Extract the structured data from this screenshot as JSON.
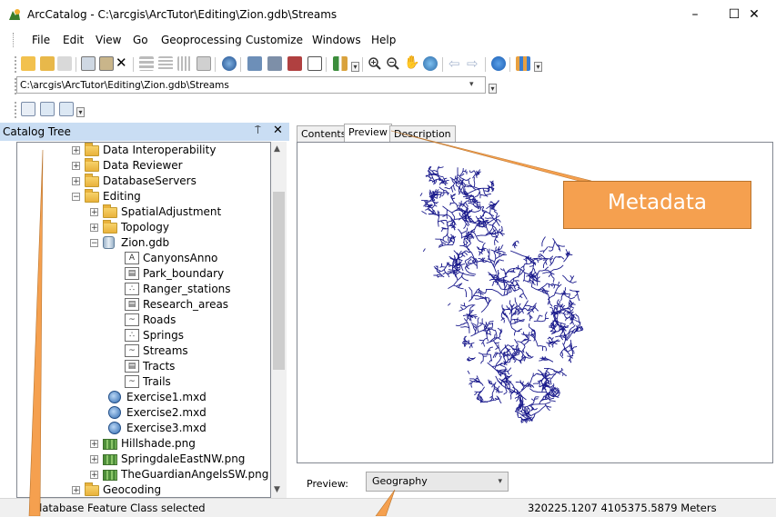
{
  "window": {
    "title": "ArcCatalog - C:\\arcgis\\ArcTutor\\Editing\\Zion.gdb\\Streams",
    "minimize": "–",
    "maximize": "☐",
    "close": "✕"
  },
  "menu": [
    "File",
    "Edit",
    "View",
    "Go",
    "Geoprocessing",
    "Customize",
    "Windows",
    "Help"
  ],
  "toolbar_icons": [
    "up-one-level-icon",
    "connect-folder-icon",
    "disconnect-folder-icon",
    "copy-icon",
    "paste-icon",
    "delete-icon",
    "large-icons-icon",
    "list-icon",
    "details-icon",
    "thumbnails-icon",
    "launch-arcmap-icon",
    "catalog-tree-icon",
    "search-window-icon",
    "arctoolbox-icon",
    "python-icon",
    "modelbuilder-icon",
    "zoom-in-icon",
    "zoom-out-icon",
    "pan-icon",
    "full-extent-icon",
    "back-icon",
    "forward-icon",
    "identify-icon",
    "generate-preview-icon"
  ],
  "location": {
    "path": "C:\\arcgis\\ArcTutor\\Editing\\Zion.gdb\\Streams"
  },
  "catalog_tree": {
    "title": "Catalog Tree",
    "pin": "⍑",
    "close": "✕",
    "items": [
      {
        "label": "Data Interoperability",
        "icon": "folder",
        "expander": "+",
        "level": 0
      },
      {
        "label": "Data Reviewer",
        "icon": "folder",
        "expander": "+",
        "level": 0
      },
      {
        "label": "DatabaseServers",
        "icon": "folder",
        "expander": "+",
        "level": 0
      },
      {
        "label": "Editing",
        "icon": "folder",
        "expander": "−",
        "level": 0
      },
      {
        "label": "SpatialAdjustment",
        "icon": "folder",
        "expander": "+",
        "level": 1
      },
      {
        "label": "Topology",
        "icon": "folder",
        "expander": "+",
        "level": 1
      },
      {
        "label": "Zion.gdb",
        "icon": "geodatabase",
        "expander": "−",
        "level": 1
      },
      {
        "label": "CanyonsAnno",
        "icon": "annotation",
        "expander": "",
        "level": 2
      },
      {
        "label": "Park_boundary",
        "icon": "polygon",
        "expander": "",
        "level": 2
      },
      {
        "label": "Ranger_stations",
        "icon": "point",
        "expander": "",
        "level": 2
      },
      {
        "label": "Research_areas",
        "icon": "polygon",
        "expander": "",
        "level": 2
      },
      {
        "label": "Roads",
        "icon": "line",
        "expander": "",
        "level": 2
      },
      {
        "label": "Springs",
        "icon": "point",
        "expander": "",
        "level": 2
      },
      {
        "label": "Streams",
        "icon": "line",
        "expander": "",
        "level": 2
      },
      {
        "label": "Tracts",
        "icon": "polygon",
        "expander": "",
        "level": 2
      },
      {
        "label": "Trails",
        "icon": "line",
        "expander": "",
        "level": 2
      },
      {
        "label": "Exercise1.mxd",
        "icon": "mxd",
        "expander": "",
        "level": 1
      },
      {
        "label": "Exercise2.mxd",
        "icon": "mxd",
        "expander": "",
        "level": 1
      },
      {
        "label": "Exercise3.mxd",
        "icon": "mxd",
        "expander": "",
        "level": 1
      },
      {
        "label": "Hillshade.png",
        "icon": "raster",
        "expander": "+",
        "level": 1
      },
      {
        "label": "SpringdaleEastNW.png",
        "icon": "raster",
        "expander": "+",
        "level": 1
      },
      {
        "label": "TheGuardianAngelsSW.png",
        "icon": "raster",
        "expander": "+",
        "level": 1
      },
      {
        "label": "Geocoding",
        "icon": "folder",
        "expander": "+",
        "level": 0
      }
    ]
  },
  "tabs": [
    {
      "label": "Contents",
      "active": false
    },
    {
      "label": "Preview",
      "active": true
    },
    {
      "label": "Description",
      "active": false
    }
  ],
  "preview": {
    "label": "Preview:",
    "type_value": "Geography",
    "stream_color": "#1a1a8c"
  },
  "status": {
    "selection": "odatabase Feature Class selected",
    "coordinates": "320225.1207  4105375.5879 Meters"
  },
  "callout": {
    "text": "Metadata",
    "color": "#f5a04f"
  },
  "colors": {
    "panel_header": "#c9ddf3",
    "accent": "#0a64c8"
  }
}
